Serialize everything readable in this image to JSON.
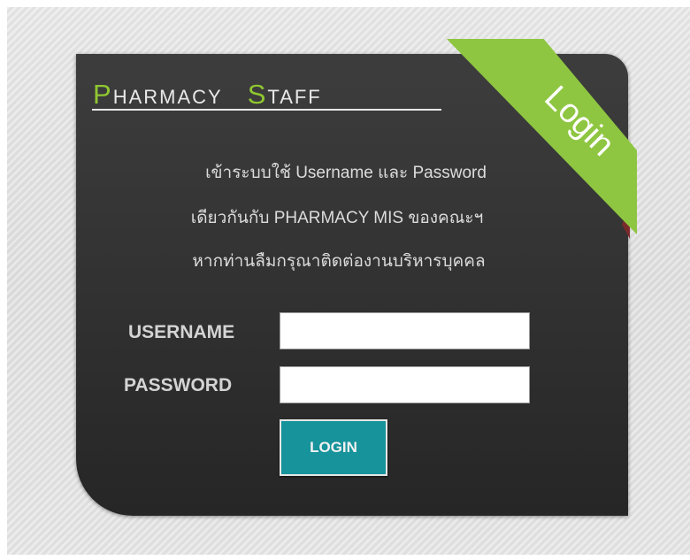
{
  "header": {
    "title_word1_initial": "P",
    "title_word1_rest": "HARMACY",
    "title_word2_initial": "S",
    "title_word2_rest": "TAFF",
    "ribbon_label": "Login"
  },
  "info": {
    "line1": "เข้าระบบใช้ Username และ Password",
    "line2": "เดียวกันกับ PHARMACY MIS ของคณะฯ",
    "line3": "หากท่านลืมกรุณาติดต่องานบริหารบุคคล"
  },
  "form": {
    "username_label": "USERNAME",
    "username_value": "",
    "password_label": "PASSWORD",
    "password_value": "",
    "submit_label": "LOGIN"
  },
  "colors": {
    "accent_green": "#8ec641",
    "button_teal": "#16939b",
    "card_dark": "#333333"
  }
}
